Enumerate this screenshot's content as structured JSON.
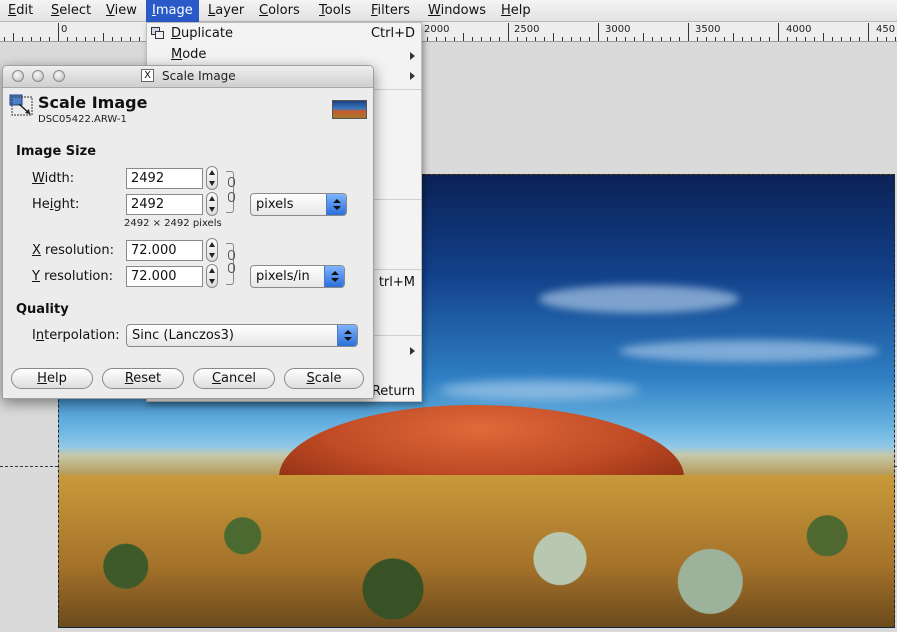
{
  "menubar": {
    "items": [
      {
        "label": "Edit",
        "mn": "E",
        "rest": "dit",
        "active": false
      },
      {
        "label": "Select",
        "mn": "S",
        "rest": "elect",
        "active": false
      },
      {
        "label": "View",
        "mn": "V",
        "rest": "iew",
        "active": false
      },
      {
        "label": "Image",
        "mn": "I",
        "rest": "mage",
        "active": true
      },
      {
        "label": "Layer",
        "mn": "L",
        "rest": "ayer",
        "active": false
      },
      {
        "label": "Colors",
        "mn": "C",
        "rest": "olors",
        "active": false
      },
      {
        "label": "Tools",
        "mn": "T",
        "rest": "ools",
        "active": false
      },
      {
        "label": "Filters",
        "mn": "F",
        "rest": "ilters",
        "active": false
      },
      {
        "label": "Windows",
        "mn": "W",
        "rest": "indows",
        "active": false
      },
      {
        "label": "Help",
        "mn": "H",
        "rest": "elp",
        "active": false
      }
    ]
  },
  "ruler": {
    "labels": [
      "0",
      "2000",
      "2500",
      "3000",
      "3500",
      "4000",
      "450"
    ]
  },
  "image_menu": {
    "duplicate": {
      "mn": "D",
      "rest": "uplicate",
      "shortcut": "Ctrl+D"
    },
    "mode": {
      "mn": "M",
      "rest": "ode"
    },
    "partial_shortcut_1": "trl+M",
    "partial_shortcut_2": "Return"
  },
  "dialog": {
    "window_title": "Scale Image",
    "x_badge": "X",
    "header_title": "Scale Image",
    "header_subtitle": "DSC05422.ARW-1",
    "image_size_heading": "Image Size",
    "width_label": {
      "mn": "W",
      "rest": "idth:"
    },
    "height_label": {
      "pre": "He",
      "mn": "i",
      "rest": "ght:"
    },
    "width_value": "2492",
    "height_value": "2492",
    "size_note": "2492 × 2492 pixels",
    "size_unit": "pixels",
    "xres_label": {
      "mn": "X",
      "rest": " resolution:"
    },
    "yres_label": {
      "mn": "Y",
      "rest": " resolution:"
    },
    "xres_value": "72.000",
    "yres_value": "72.000",
    "res_unit": "pixels/in",
    "quality_heading": "Quality",
    "interp_label": {
      "pre": "I",
      "mn": "n",
      "rest": "terpolation:"
    },
    "interp_value": "Sinc (Lanczos3)",
    "buttons": {
      "help": {
        "mn": "H",
        "rest": "elp"
      },
      "reset": {
        "mn": "R",
        "rest": "eset"
      },
      "cancel": {
        "mn": "C",
        "rest": "ancel"
      },
      "scale": {
        "mn": "S",
        "rest": "cale"
      }
    }
  }
}
